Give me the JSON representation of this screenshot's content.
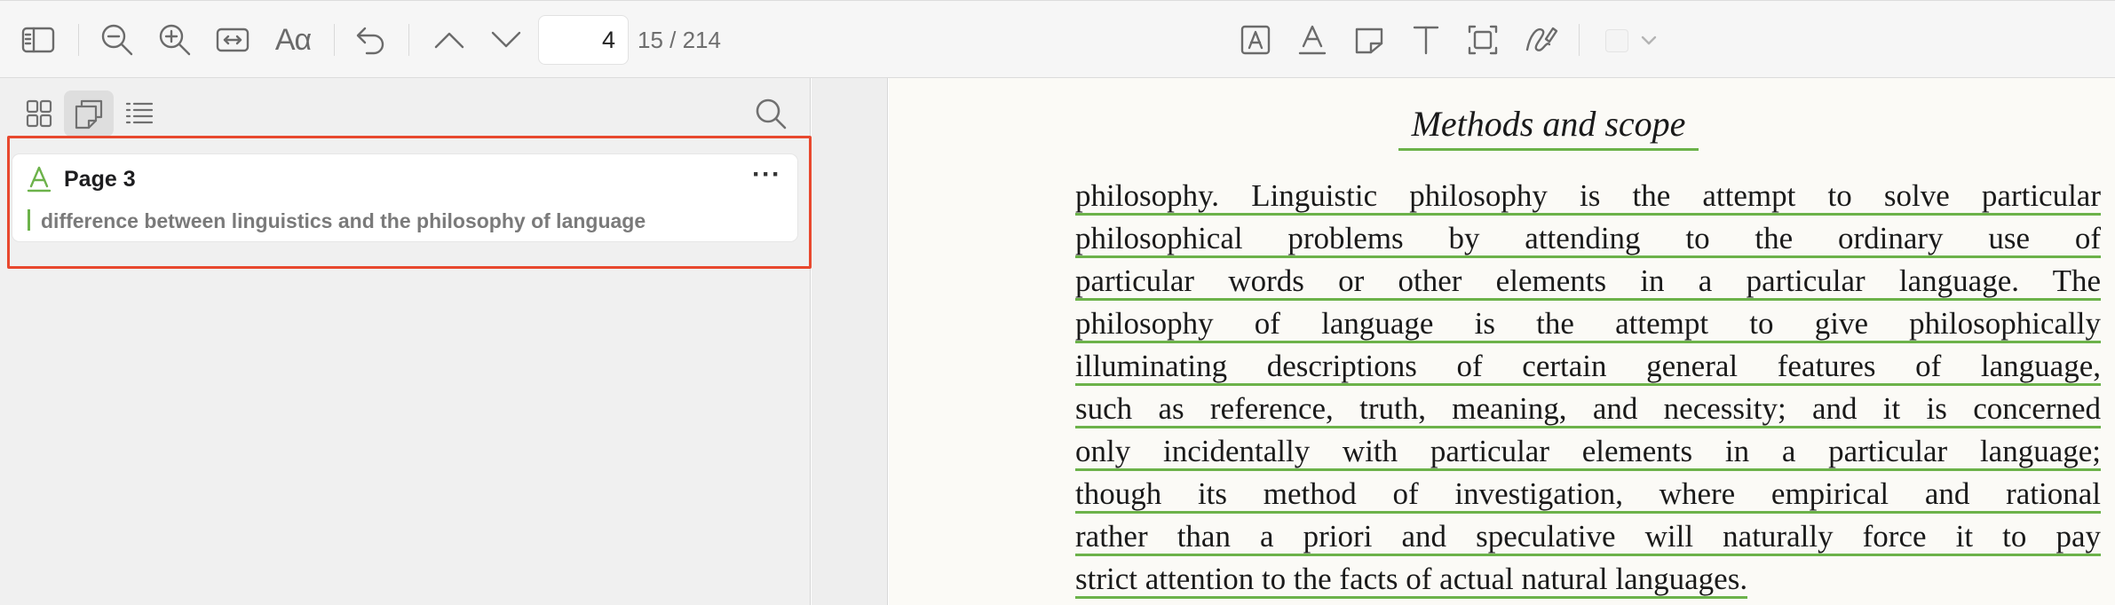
{
  "toolbar": {
    "icons": [
      "sidebar-toggle-icon",
      "zoom-out-icon",
      "zoom-in-icon",
      "fit-width-icon",
      "text-size-icon",
      "undo-icon",
      "previous-page-icon",
      "next-page-icon",
      "text-box-icon",
      "underline-icon",
      "note-icon",
      "text-tool-icon",
      "selection-icon",
      "signature-icon",
      "color-dropdown-icon"
    ],
    "text_size_label": "Aα",
    "page_field_value": "4",
    "page_count": "15 / 214"
  },
  "sidebar": {
    "view_modes": [
      "thumbnails-icon",
      "annotations-icon",
      "outline-icon"
    ],
    "active_view": "annotations",
    "search_icon": "search-icon",
    "annotation": {
      "type_icon": "highlight-text-icon",
      "title": "Page 3",
      "more_label": "···",
      "quote": "difference between linguistics and the philosophy of language"
    }
  },
  "document": {
    "heading": "Methods and scope",
    "lines": [
      "philosophy. Linguistic philosophy is the attempt to solve particular",
      "philosophical problems by attending to the ordinary use of",
      "particular words or other elements in a particular language. The",
      "philosophy of language is the attempt to give philosophically",
      "illuminating descriptions of certain general features of language,",
      "such as reference, truth, meaning, and necessity; and it is concerned",
      "only incidentally with particular elements in a particular language;",
      "though its method of investigation, where empirical and rational",
      "rather than a priori and speculative will naturally force it to pay",
      "strict attention to the facts of actual natural languages."
    ]
  },
  "colors": {
    "highlight_underline": "#6cb24a",
    "selection_outline": "#e8482e",
    "toolbar_background": "#f6f6f6",
    "sidebar_background": "#f0f0f0",
    "page_background": "#fbfaf6"
  }
}
